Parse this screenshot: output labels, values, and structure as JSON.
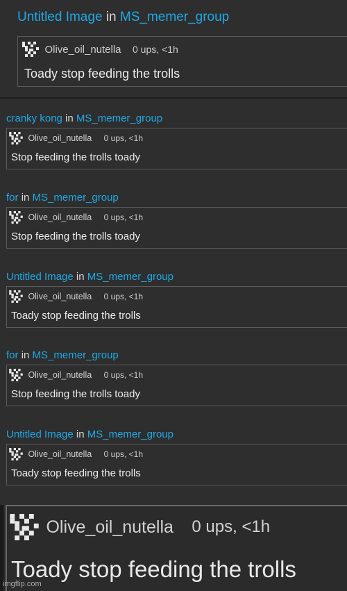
{
  "top": {
    "post_title": "Untitled Image",
    "in_word": "in",
    "group": "MS_memer_group",
    "username": "Olive_oil_nutella",
    "stats": "0 ups, <1h",
    "comment": "Toady stop feeding the trolls"
  },
  "notifications": [
    {
      "post_title": "cranky kong",
      "in_word": "in",
      "group": "MS_memer_group",
      "username": "Olive_oil_nutella",
      "stats": "0 ups, <1h",
      "comment": "Stop feeding the trolls toady"
    },
    {
      "post_title": "for",
      "in_word": "in",
      "group": "MS_memer_group",
      "username": "Olive_oil_nutella",
      "stats": "0 ups, <1h",
      "comment": "Stop feeding the trolls toady"
    },
    {
      "post_title": "Untitled Image",
      "in_word": "in",
      "group": "MS_memer_group",
      "username": "Olive_oil_nutella",
      "stats": "0 ups, <1h",
      "comment": "Toady stop feeding the trolls"
    },
    {
      "post_title": "for",
      "in_word": "in",
      "group": "MS_memer_group",
      "username": "Olive_oil_nutella",
      "stats": "0 ups, <1h",
      "comment": "Stop feeding the trolls toady"
    },
    {
      "post_title": "Untitled Image",
      "in_word": "in",
      "group": "MS_memer_group",
      "username": "Olive_oil_nutella",
      "stats": "0 ups, <1h",
      "comment": "Toady stop feeding the trolls"
    }
  ],
  "zoom": {
    "username": "Olive_oil_nutella",
    "stats": "0 ups, <1h",
    "comment": "Toady stop feeding the trolls"
  },
  "watermark": "imgflip.com",
  "colors": {
    "link": "#1fa9e6",
    "background": "#2e2e2e",
    "border": "#5c5c5c",
    "text": "#ececec"
  },
  "icons": {
    "avatar": "pixel-avatar-icon"
  }
}
